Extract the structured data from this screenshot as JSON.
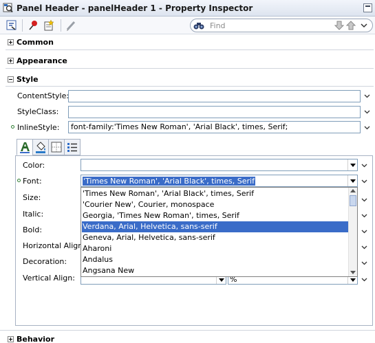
{
  "window": {
    "title": "Panel Header - panelHeader 1 - Property Inspector"
  },
  "search": {
    "placeholder": "Find"
  },
  "sections": {
    "common": "Common",
    "appearance": "Appearance",
    "style": "Style",
    "behavior": "Behavior"
  },
  "style_props": {
    "content_style": {
      "label": "ContentStyle:",
      "value": ""
    },
    "style_class": {
      "label": "StyleClass:",
      "value": ""
    },
    "inline_style": {
      "label": "InlineStyle:",
      "value": "font-family:'Times New Roman', 'Arial Black', times, Serif;"
    }
  },
  "font_editor": {
    "color": {
      "label": "Color:",
      "value": ""
    },
    "font": {
      "label": "Font:",
      "value": "'Times New Roman', 'Arial Black', times, Serif"
    },
    "size": {
      "label": "Size:"
    },
    "italic": {
      "label": "Italic:"
    },
    "bold": {
      "label": "Bold:"
    },
    "horizontal_align": {
      "label": "Horizontal Align:"
    },
    "decoration": {
      "label": "Decoration:"
    },
    "vertical_align": {
      "label": "Vertical Align:",
      "unit": "%"
    }
  },
  "font_options": [
    "'Times New Roman', 'Arial Black', times, Serif",
    "'Courier New', Courier, monospace",
    "Georgia, 'Times New Roman', times, Serif",
    "Verdana, Arial, Helvetica, sans-serif",
    "Geneva, Arial, Helvetica, sans-serif",
    "Aharoni",
    "Andalus",
    "Angsana New"
  ],
  "selected_font_option": "Verdana, Arial, Helvetica, sans-serif",
  "colors": {
    "selection": "#3a6cc8",
    "modified_dot": "#2e7d32",
    "field_border": "#7f9db9"
  }
}
